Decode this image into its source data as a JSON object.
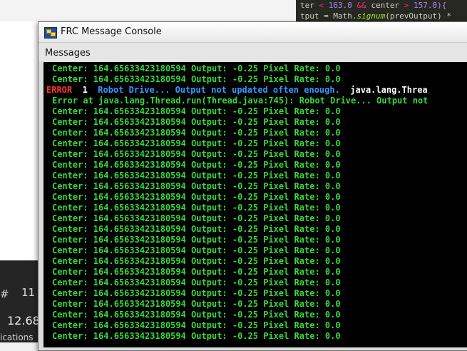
{
  "background": {
    "code_lines": [
      {
        "a": "ter ",
        "b": "<",
        "c": " 163.0 ",
        "d": "&&",
        "e": " center ",
        "f": ">",
        "g": " 157.0){"
      },
      {
        "a": "tput = Math.",
        "it": "signum",
        "b2": "(prevOutput) *"
      },
      {
        "faint": "    ...."
      },
      {
        "faint": "        ...."
      }
    ],
    "left_labels": {
      "hash": "#",
      "num": "11",
      "value": "12.68",
      "apps": "ications"
    }
  },
  "window": {
    "title": "FRC Message Console",
    "section": "Messages"
  },
  "console": {
    "normal_line": "Center: 164.65633423180594 Output: -0.25 Pixel Rate: 0.0",
    "error_line": {
      "tag": "ERROR",
      "num": "1",
      "msg": "Robot Drive... Output not updated often enough.",
      "exc": "java.lang.Threa"
    },
    "error_at": "Error at java.lang.Thread.run(Thread.java:745): Robot Drive... Output not"
  },
  "colors": {
    "console_green": "#36d93a",
    "error_red": "#ff3333",
    "error_blue": "#3399ff"
  }
}
